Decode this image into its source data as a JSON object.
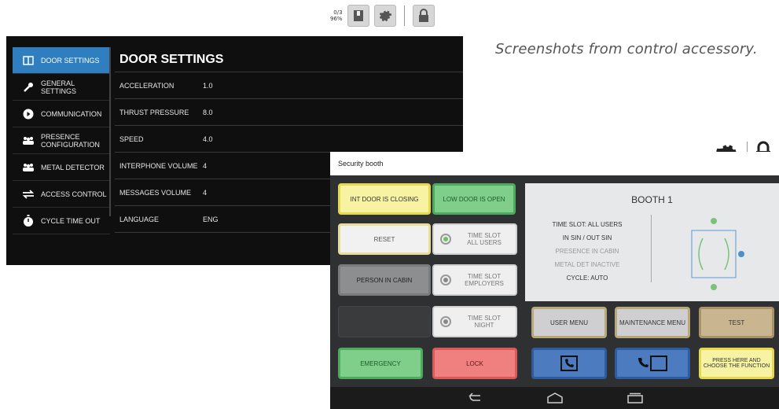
{
  "status": {
    "line1": "0/3",
    "line2": "96%"
  },
  "caption": "Screenshots from control accessory.",
  "door_settings": {
    "sidebar": [
      {
        "label": "DOOR SETTINGS",
        "icon": "door-icon"
      },
      {
        "label": "GENERAL SETTINGS",
        "icon": "wrench-icon"
      },
      {
        "label": "COMMUNICATION",
        "icon": "play-icon"
      },
      {
        "label": "PRESENCE CONFIGURATION",
        "icon": "people-icon"
      },
      {
        "label": "METAL DETECTOR",
        "icon": "people-icon"
      },
      {
        "label": "ACCESS CONTROL",
        "icon": "arrows-icon"
      },
      {
        "label": "CYCLE TIME OUT",
        "icon": "stopwatch-icon"
      }
    ],
    "title": "DOOR SETTINGS",
    "rows": [
      {
        "label": "ACCELERATION",
        "value": "1.0"
      },
      {
        "label": "THRUST PRESSURE",
        "value": "8.0"
      },
      {
        "label": "SPEED",
        "value": "4.0"
      },
      {
        "label": "INTERPHONE VOLUME",
        "value": "4"
      },
      {
        "label": "MESSAGES VOLUME",
        "value": "4"
      },
      {
        "label": "LANGUAGE",
        "value": "ENG"
      }
    ]
  },
  "booth": {
    "header": "Security booth",
    "buttons": {
      "int_door": "INT DOOR IS CLOSING",
      "low_door": "LOW DOOR IS OPEN",
      "reset": "RESET",
      "slot_all": "TIME SLOT ALL USERS",
      "person": "PERSON IN CABIN",
      "slot_emp": "TIME SLOT EMPLOYERS",
      "slot_night": "TIME SLOT NIGHT",
      "user_menu": "USER MENU",
      "maint_menu": "MAINTENANCE MENU",
      "test": "TEST",
      "emergency": "EMERGENCY",
      "lock": "LOCK",
      "press_here": "PRESS HERE AND CHOOSE THE FUNCTION"
    },
    "card": {
      "title": "BOOTH 1",
      "lines": [
        "TIME SLOT: ALL USERS",
        "IN SIN / OUT SIN",
        "PRESENCE IN CABIN",
        "METAL DET INACTIVE",
        "CYCLE: AUTO"
      ]
    }
  },
  "colors": {
    "accent": "#2f7fc0",
    "panel_bg": "#0f0f10",
    "booth_bg": "#2f3031"
  }
}
